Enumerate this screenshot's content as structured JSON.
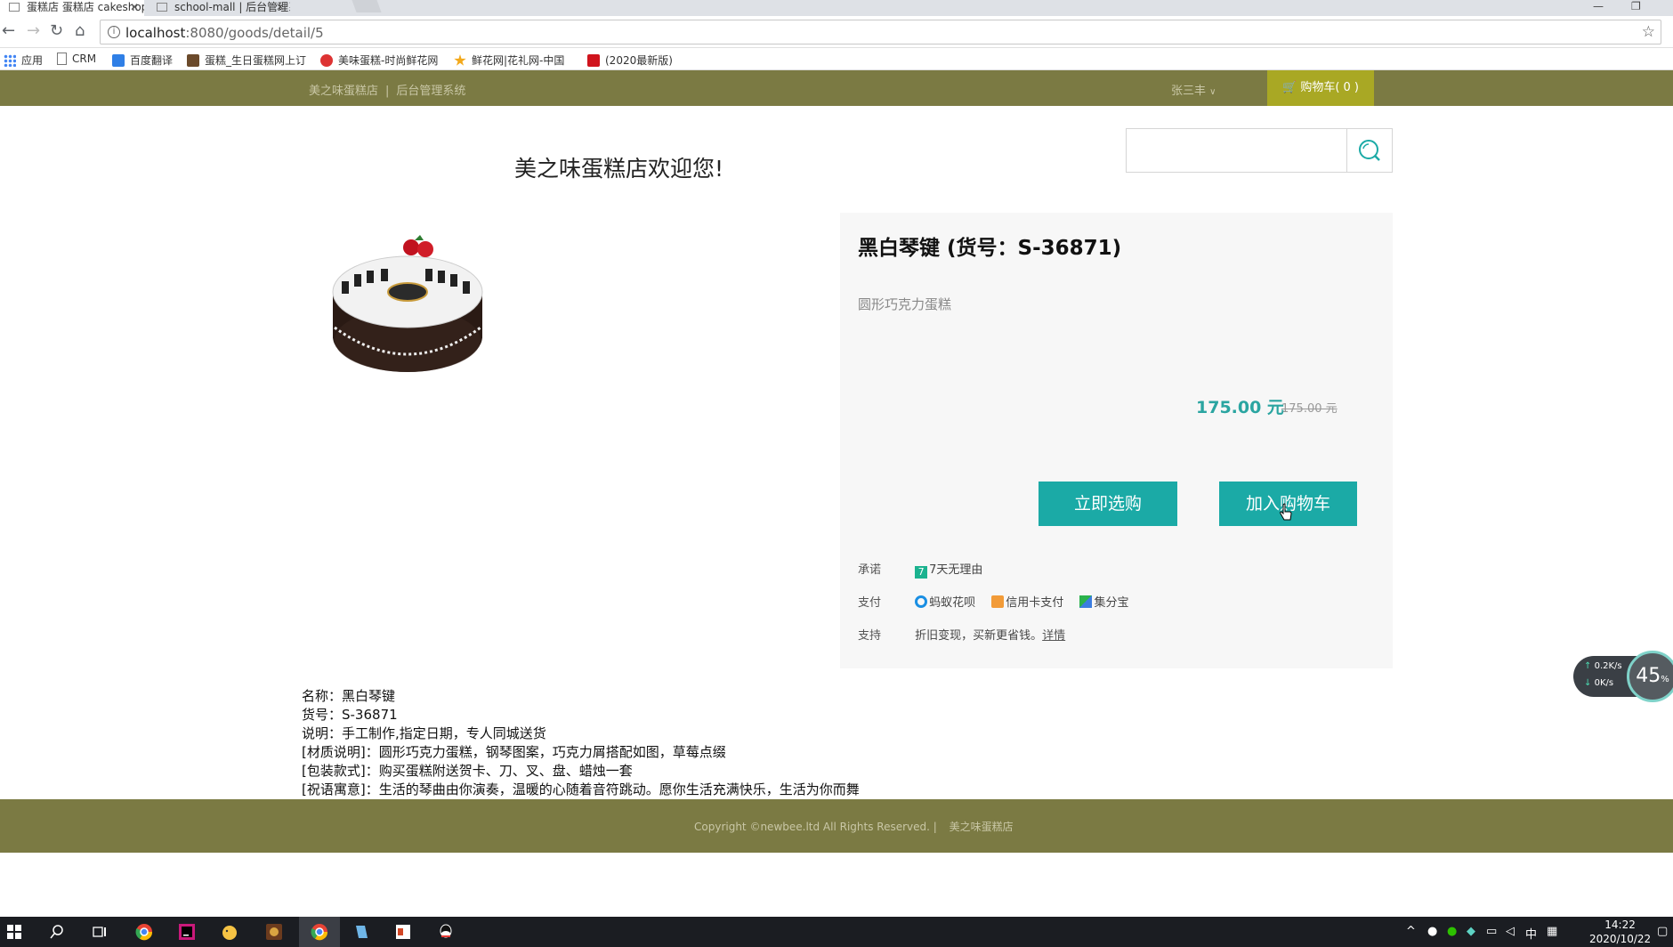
{
  "browser": {
    "tabs": [
      {
        "title": "蛋糕店 蛋糕店 cakeshop",
        "active": true
      },
      {
        "title": "school-mall | 后台管理系",
        "active": false
      }
    ],
    "url_host": "localhost",
    "url_path": ":8080/goods/detail/5",
    "bookmarks": [
      "应用",
      "CRM",
      "百度翻译",
      "蛋糕_生日蛋糕网上订",
      "美味蛋糕-时尚鲜花网",
      "鲜花网|花礼网-中国",
      "(2020最新版)"
    ]
  },
  "site": {
    "brand": "美之味蛋糕店",
    "admin_link": "后台管理系统",
    "user": "张三丰",
    "cart_label": "购物车( 0 )",
    "welcome": "美之味蛋糕店欢迎您!",
    "search_placeholder": ""
  },
  "product": {
    "title": "黑白琴键 (货号：S-36871)",
    "subtitle": "圆形巧克力蛋糕",
    "price": "175.00 元",
    "original_price": "175.00 元",
    "buy_label": "立即选购",
    "cart_label": "加入购物车",
    "promise_label": "承诺",
    "promise_value": "7天无理由",
    "pay_label": "支付",
    "pay_methods": [
      "蚂蚁花呗",
      "信用卡支付",
      "集分宝"
    ],
    "support_label": "支持",
    "support_text": "折旧变现，买新更省钱。",
    "support_link": "详情"
  },
  "details": [
    "名称：黑白琴键",
    "货号：S-36871",
    "说明：手工制作,指定日期，专人同城送货",
    "[材质说明]：圆形巧克力蛋糕，钢琴图案，巧克力屑搭配如图，草莓点缀",
    "[包装款式]：购买蛋糕附送贺卡、刀、叉、盘、蜡烛一套",
    "[祝语寓意]：生活的琴曲由你演奏，温暖的心随着音符跳动。愿你生活充满快乐，生活为你而舞"
  ],
  "footer": {
    "copyright": "Copyright ©newbee.ltd All Rights Reserved.  |",
    "brand": "美之味蛋糕店"
  },
  "widget": {
    "up": "0.2K/s",
    "down": "0K/s",
    "percent": "45"
  },
  "taskbar": {
    "ime": "中",
    "time": "14:22",
    "date": "2020/10/22"
  }
}
